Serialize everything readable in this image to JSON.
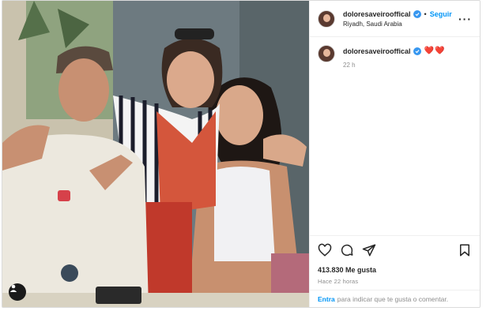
{
  "post": {
    "username": "doloresaveirooffical",
    "follow_label": "Seguir",
    "location": "Riyadh, Saudi Arabia",
    "more_icon": "more-horizontal-icon",
    "caption": {
      "username": "doloresaveirooffical",
      "emoji": "❤️❤️",
      "time": "22 h"
    },
    "likes": "413.830 Me gusta",
    "posted_ago": "Hace 22 horas",
    "comment_prompt": {
      "login": "Entra",
      "rest": "para indicar que te gusta o comentar."
    },
    "icons": [
      "heart-icon",
      "comment-icon",
      "share-icon",
      "bookmark-icon",
      "user-tag-icon"
    ],
    "colors": {
      "verified": "#3797f0",
      "link": "#0095f6",
      "heart": "#ed4956"
    }
  }
}
